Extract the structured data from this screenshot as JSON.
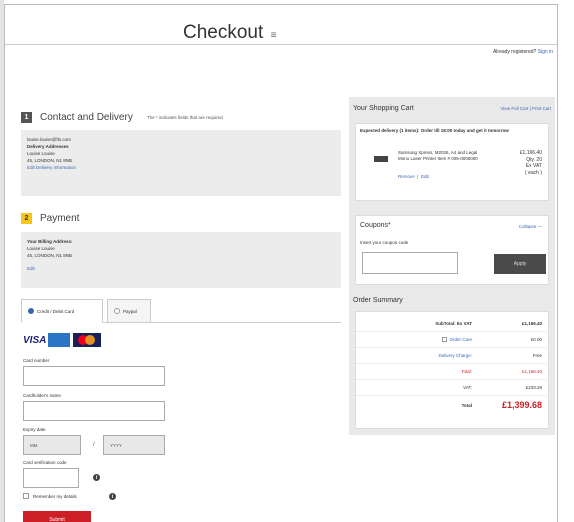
{
  "header": {
    "title": "Checkout",
    "title_icon": "≡",
    "registered_text": "Already registered?",
    "sign_in_label": "Sign in"
  },
  "contact": {
    "step": "1",
    "title": "Contact and Delivery",
    "note": "The * indicates fields that are required.",
    "email": "louise.louise@fts.com",
    "delivery_label": "Delivery Addresses",
    "address_lines": [
      "Louise Louise",
      "45, LONDON, N1 8NB"
    ],
    "edit_delivery_label": "Edit Delivery Information"
  },
  "payment": {
    "step": "2",
    "title": "Payment",
    "billing_label": "Your Billing Address:",
    "address_lines": [
      "Louise Louise",
      "45, LONDON, N1 8NB"
    ],
    "edit_label": "Edit",
    "tabs": [
      {
        "label": "Credit / Debit Card",
        "selected": true
      },
      {
        "label": "Paypal",
        "selected": false
      }
    ],
    "card_brands": [
      "VISA",
      "American Express",
      "Mastercard"
    ],
    "fields": {
      "card_number_label": "Card number",
      "cardholder_label": "Cardholder's name",
      "expiry_label": "Expiry date",
      "expiry_month": "MM",
      "expiry_year": "YYYY",
      "expiry_sep": "/",
      "cvc_label": "Card verification code"
    },
    "remember_label": "Remember my details",
    "submit_label": "Submit"
  },
  "cart": {
    "title": "Your Shopping Cart",
    "view_print_label": "View Full Cart | Print Cart",
    "expected_delivery": "Expected delivery (1 items): Order till 18:00 today and get it tomorrow",
    "item": {
      "description": "Samsung Xpress, M2026, A4 and Legal Mono Laser Printer Item # 005-0000000",
      "price": "£1,166.40",
      "qty": "Qty. 20",
      "tax_note": "Ex VAT",
      "unit_note": "( each )",
      "remove_label": "Remove",
      "sep": "|",
      "edit_label": "Edit"
    }
  },
  "coupon": {
    "title": "Coupons*",
    "collapse_label": "Collapse —",
    "insert_label": "Insert your coupon code",
    "apply_label": "Apply"
  },
  "summary": {
    "title": "Order Summary",
    "rows": [
      {
        "key": "SubTotal: Ex VAT",
        "value": "£1,166.40"
      },
      {
        "key": "Order Care",
        "value": "£0.00"
      },
      {
        "key": "Delivery Charge:",
        "value": "Free"
      },
      {
        "key": "Total:",
        "value": "£1,166.40"
      },
      {
        "key": "VAT:",
        "value": "£233.28"
      },
      {
        "key": "Total",
        "value": "£1,399.68"
      }
    ]
  },
  "colors": {
    "accent_blue": "#3a66b0",
    "submit_red": "#cc1f26",
    "step_yellow": "#f5c518"
  }
}
